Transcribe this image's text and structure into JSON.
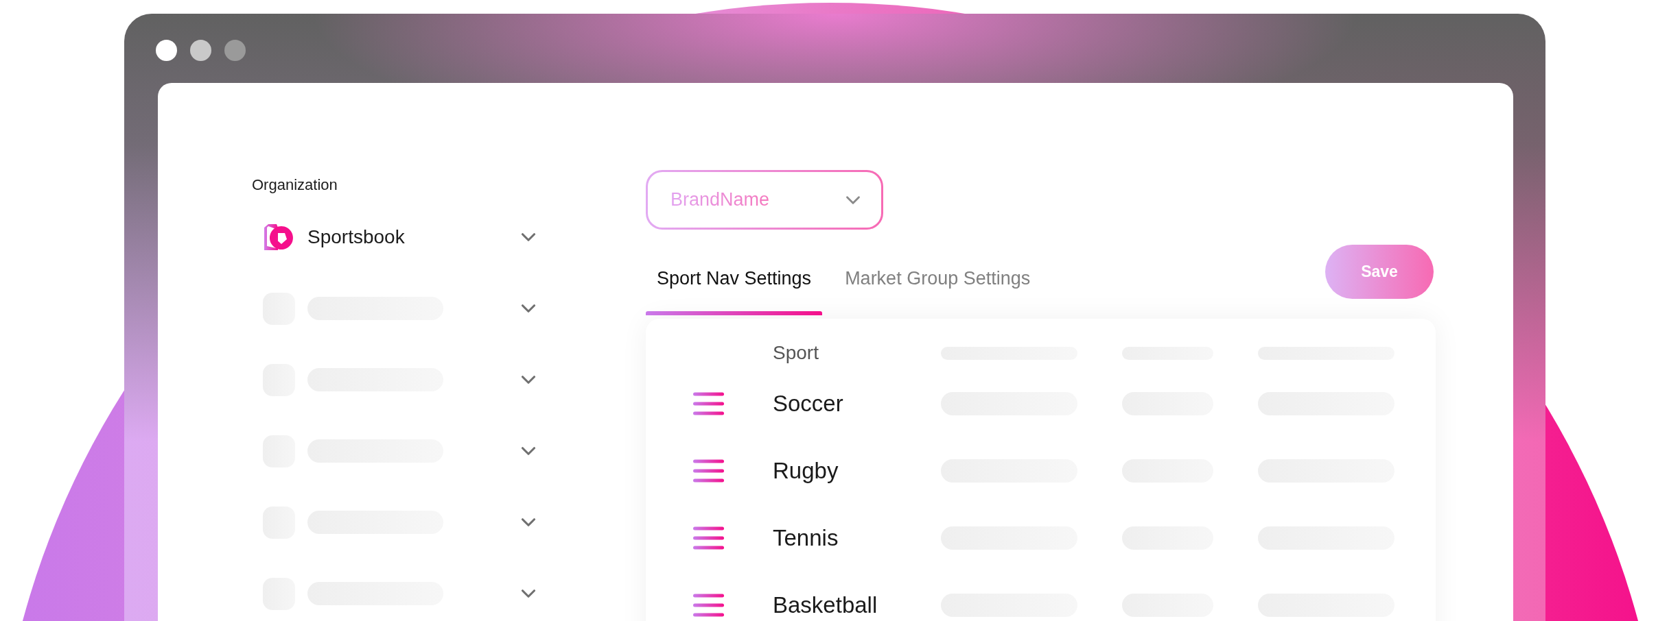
{
  "sidebar": {
    "heading": "Organization",
    "items": [
      {
        "kind": "item",
        "label": "Sportsbook"
      },
      {
        "kind": "skeleton"
      },
      {
        "kind": "skeleton"
      },
      {
        "kind": "skeleton"
      },
      {
        "kind": "skeleton"
      },
      {
        "kind": "skeleton"
      }
    ]
  },
  "brand_select": {
    "value": "BrandName"
  },
  "tabs": [
    {
      "label": "Sport Nav Settings",
      "selected": true
    },
    {
      "label": "Market Group Settings",
      "selected": false
    }
  ],
  "save_button": "Save",
  "table": {
    "columns": [
      "Sport"
    ],
    "rows": [
      {
        "name": "Soccer"
      },
      {
        "name": "Rugby"
      },
      {
        "name": "Tennis"
      },
      {
        "name": "Basketball"
      }
    ]
  }
}
